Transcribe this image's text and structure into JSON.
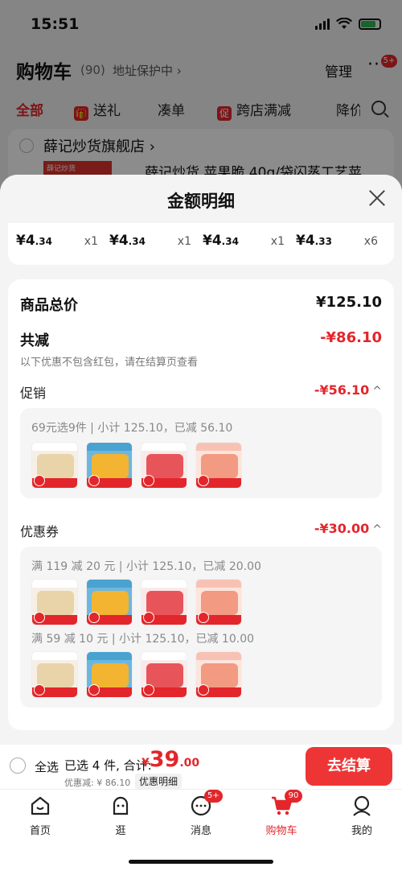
{
  "status_bar": {
    "time": "15:51"
  },
  "cart_header": {
    "title": "购物车",
    "count": "(90)",
    "address_protect": "地址保护中 ›",
    "manage": "管理",
    "more": "···",
    "more_badge": "5+"
  },
  "tabs": [
    {
      "label": "全部",
      "icon": ""
    },
    {
      "label": "送礼",
      "icon": "gift-icon"
    },
    {
      "label": "凑单",
      "icon": ""
    },
    {
      "label": "跨店满减",
      "icon": "promo-tag-icon"
    },
    {
      "label": "降价",
      "icon": ""
    }
  ],
  "tabs_icon_text": {
    "promo": "促"
  },
  "shop": {
    "name": "薛记炒货旗舰店 ›",
    "thumb_text": "薛记炒货",
    "product_title": "薛记炒货 苹果脆 40g/袋闪蒸工艺苹"
  },
  "sheet": {
    "title": "金额明细",
    "items": [
      {
        "price_int": "¥4",
        "price_dec": ".34",
        "qty": "x1"
      },
      {
        "price_int": "¥4",
        "price_dec": ".34",
        "qty": "x1"
      },
      {
        "price_int": "¥4",
        "price_dec": ".34",
        "qty": "x1"
      },
      {
        "price_int": "¥4",
        "price_dec": ".33",
        "qty": "x6"
      }
    ],
    "goods_total_label": "商品总价",
    "goods_total_value": "¥125.10",
    "total_reduce_label": "共减",
    "total_reduce_value": "-¥86.10",
    "note": "以下优惠不包含红包，请在结算页查看",
    "promotion": {
      "label": "促销",
      "value": "-¥56.10",
      "caret": "^",
      "rule": "69元选9件 | 小计 125.10，已减 56.10"
    },
    "coupon": {
      "label": "优惠券",
      "value": "-¥30.00",
      "caret": "^",
      "rule1": "满 119 减 20 元 | 小计 125.10，已减 20.00",
      "rule2": "满 59 减 10 元 | 小计 125.10，已减 10.00"
    }
  },
  "checkout": {
    "select_all": "全选",
    "selected": "已选 4 件, 合计:",
    "yen": "¥",
    "total_int": "39",
    "total_dec": ".00",
    "discount": "优惠减: ¥ 86.10",
    "detail_toggle": "优惠明细",
    "button": "去结算"
  },
  "nav": [
    {
      "label": "首页",
      "icon": "home-icon",
      "badge": ""
    },
    {
      "label": "逛",
      "icon": "browse-icon",
      "badge": ""
    },
    {
      "label": "消息",
      "icon": "message-icon",
      "badge": "5+"
    },
    {
      "label": "购物车",
      "icon": "cart-icon",
      "badge": "90"
    },
    {
      "label": "我的",
      "icon": "profile-icon",
      "badge": ""
    }
  ],
  "colors": {
    "accent": "#e3262b",
    "checkout_button": "#ee3535",
    "sheet_bg": "#f4f4f4"
  }
}
